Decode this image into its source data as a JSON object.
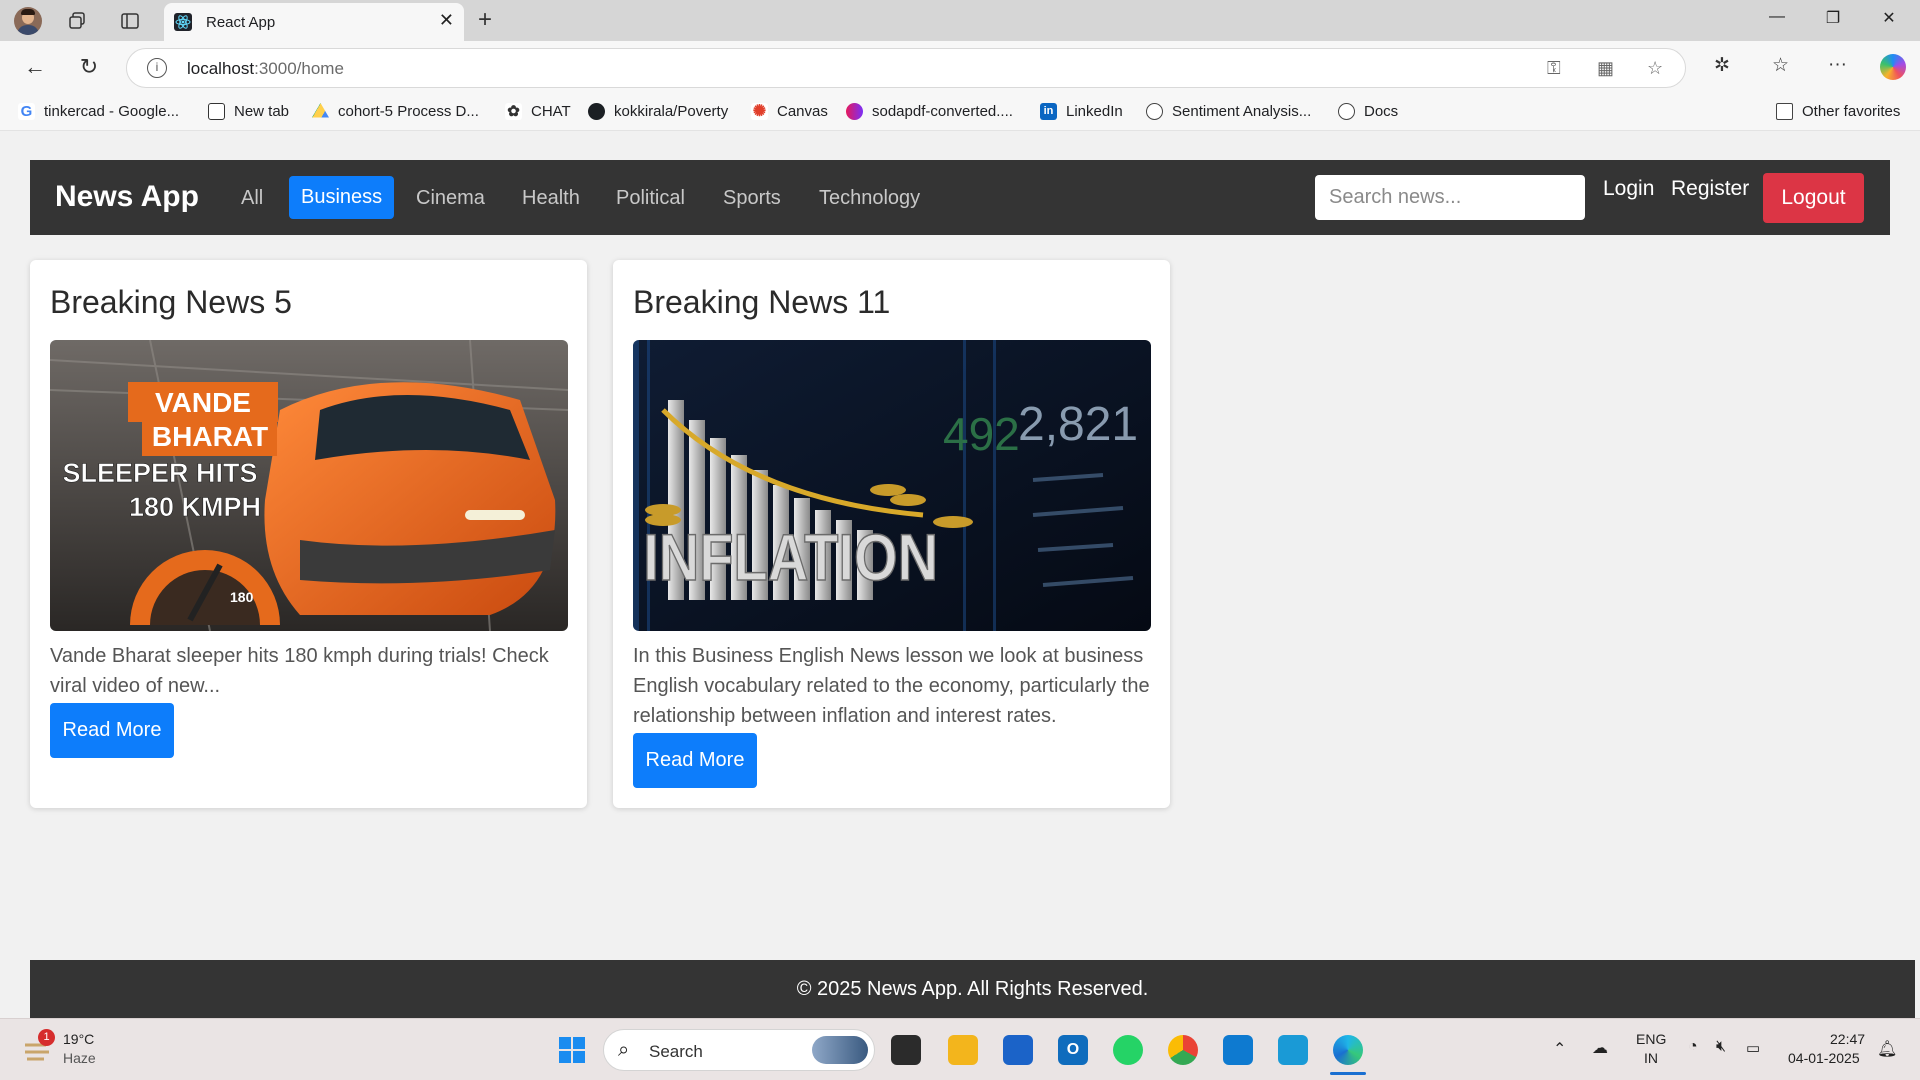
{
  "browser": {
    "tab_title": "React App",
    "url_host": "localhost",
    "url_rest": ":3000/home",
    "bookmarks": [
      {
        "label": "tinkercad - Google...",
        "icon": "google-icon"
      },
      {
        "label": "New tab",
        "icon": "new-tab-icon"
      },
      {
        "label": "cohort-5 Process D...",
        "icon": "google-drive-icon"
      },
      {
        "label": "CHAT",
        "icon": "openai-icon"
      },
      {
        "label": "kokkirala/Poverty",
        "icon": "github-icon"
      },
      {
        "label": "Canvas",
        "icon": "canvas-icon"
      },
      {
        "label": "sodapdf-converted....",
        "icon": "pdf-icon"
      },
      {
        "label": "LinkedIn",
        "icon": "linkedin-icon"
      },
      {
        "label": "Sentiment Analysis...",
        "icon": "globe-icon"
      },
      {
        "label": "Docs",
        "icon": "globe-icon"
      }
    ],
    "other_favorites": "Other favorites"
  },
  "app": {
    "brand": "News App",
    "nav": [
      {
        "label": "All",
        "active": false
      },
      {
        "label": "Business",
        "active": true
      },
      {
        "label": "Cinema",
        "active": false
      },
      {
        "label": "Health",
        "active": false
      },
      {
        "label": "Political",
        "active": false
      },
      {
        "label": "Sports",
        "active": false
      },
      {
        "label": "Technology",
        "active": false
      }
    ],
    "search_placeholder": "Search news...",
    "login": "Login",
    "register": "Register",
    "logout": "Logout",
    "accent_color": "#0d7dfb",
    "logout_color": "#dc3545",
    "navbar_color": "#343434"
  },
  "cards": [
    {
      "title": "Breaking News 5",
      "image_text": [
        "VANDE",
        "BHARAT",
        "SLEEPER HITS",
        "180 KMPH",
        "180"
      ],
      "description": "Vande Bharat sleeper hits 180 kmph during trials! Check viral video of new...",
      "button": "Read More"
    },
    {
      "title": "Breaking News 11",
      "image_text": [
        "INFLATION",
        "2,821",
        "492"
      ],
      "description": "In this Business English News lesson we look at business English vocabulary related to the economy, particularly the relationship between inflation and interest rates.",
      "button": "Read More"
    }
  ],
  "footer": "© 2025 News App. All Rights Reserved.",
  "taskbar": {
    "weather_temp": "19°C",
    "weather_desc": "Haze",
    "weather_badge": "1",
    "search_label": "Search",
    "lang_top": "ENG",
    "lang_bottom": "IN",
    "time": "22:47",
    "date": "04-01-2025"
  }
}
